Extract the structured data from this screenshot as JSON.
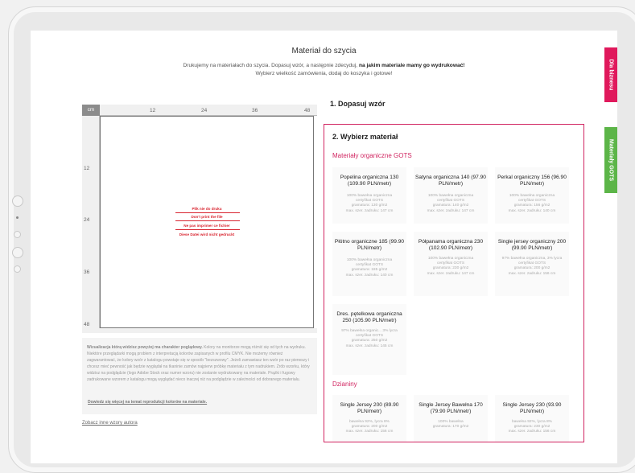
{
  "header": {
    "title": "Materiał do szycia",
    "line1_prefix": "Drukujemy na materiałach do szycia. Dopasuj wzór, a następnie zdecyduj, ",
    "line1_bold": "na jakim materiale mamy go wydrukować!",
    "line2": "Wybierz wielkość zamówienia, dodaj do koszyka i gotowe!"
  },
  "ruler": {
    "unit": "cm",
    "top_ticks": [
      "12",
      "24",
      "36",
      "48"
    ],
    "left_ticks": [
      "12",
      "24",
      "36",
      "48"
    ]
  },
  "preview_warnings": [
    "Plik nie do druku",
    "Don't print the file",
    "Ne pas imprimer ce fichier",
    "Diese Datei wird nicht gedruckt"
  ],
  "info": {
    "bold": "Wizualizacja którą widzisz powyżej ma charakter poglądowy.",
    "text": " Kolory na monitorze mogą różnić się od tych na wydruku. Niektóre przeglądarki mogą problem z interpretacją kolorów zapisanych w profilu CMYK. Nie możemy również zagwarantować, że kolory wzór z katalogu powstaje się w sposób \"bezszwowy\". Jeżeli zamawiasz ten wzór po raz pierwszy i chcesz mieć pewność jak będzie wyglądał na tkaninie zamów najpierw próbkę materiału z tym nadrukiem. Zrób wzorku, który widzisz na podglądzie (logo Adobe Stock oraz numer wzoru) nie zostanie wydrukowany na materiale. Prążki i fugowy zadrukowane wzorem z katalogu mogą wyglądać nieco inaczej niż na podglądzie w zależności od dobranego materiału.",
    "link": "Dowiedz się więcej na temat reprodukcji kolorów na materiale."
  },
  "author_link": "Zobacz inne wzory autora",
  "step1_title": "1. Dopasuj wzór",
  "step2_title": "2. Wybierz materiał",
  "sections": {
    "organic": "Materiały organiczne GOTS",
    "knits": "Dzianiny"
  },
  "organic_materials": [
    {
      "name": "Popelina organiczna 130 (109.90 PLN/metr)",
      "d1": "100% bawełna organiczna",
      "d2": "certyfikat GOTS",
      "d3": "gramatura: 130 g/m2",
      "d4": "max. szer. zadruku: 147 cm"
    },
    {
      "name": "Satyna organiczna 140 (97.90 PLN/metr)",
      "d1": "100% bawełna organiczna",
      "d2": "certyfikat GOTS",
      "d3": "gramatura: 140 g/m2",
      "d4": "max. szer. zadruku: 147 cm"
    },
    {
      "name": "Perkal organiczny 156 (96.90 PLN/metr)",
      "d1": "100% bawełna organiczna",
      "d2": "certyfikat GOTS",
      "d3": "gramatura: 156 g/m2",
      "d4": "max. szer. zadruku: 140 cm"
    },
    {
      "name": "Płótno organiczne 185 (99.90 PLN/metr)",
      "d1": "100% bawełna organiczna",
      "d2": "certyfikat GOTS",
      "d3": "gramatura: 185 g/m2",
      "d4": "max. szer. zadruku: 140 cm"
    },
    {
      "name": "Półpanama organiczna 230 (102.90 PLN/metr)",
      "d1": "100% bawełna organiczna",
      "d2": "certyfikat GOTS",
      "d3": "gramatura: 230 g/m2",
      "d4": "max. szer. zadruku: 147 cm"
    },
    {
      "name": "Single jersey organiczny 200 (99.90 PLN/metr)",
      "d1": "97% bawełna organiczna, 3% lycra",
      "d2": "certyfikat GOTS",
      "d3": "gramatura: 200 g/m2",
      "d4": "max. szer. zadruku: 156 cm"
    },
    {
      "name": "Dres. pętelkowa organiczna 250 (105.90 PLN/metr)",
      "d1": "97% bawełna organic... 3% lycra",
      "d2": "certyfikat GOTS",
      "d3": "gramatura: 250 g/m2",
      "d4": "max. szer. zadruku: 145 cm"
    }
  ],
  "knit_materials": [
    {
      "name": "Single Jersey 200 (89.90 PLN/metr)",
      "d1": "bawełna 92%, lycra 8%",
      "d2": "gramatura: 200 g/m2",
      "d3": "max. szer. zadruku: 156 cm"
    },
    {
      "name": "Single Jersey Bawełna 170 (79.90 PLN/metr)",
      "d1": "100% bawełna",
      "d2": "gramatura: 170 g/m2",
      "d3": ""
    },
    {
      "name": "Single Jersey 230 (93.90 PLN/metr)",
      "d1": "bawełna 92%, lycra 8%",
      "d2": "gramatura: 230 g/m2",
      "d3": "max. szer. zadruku: 156 cm"
    }
  ],
  "side_tabs": {
    "business": "Dla biznesu",
    "gots": "Materiały GOTS"
  },
  "colors": {
    "accent": "#d12561",
    "business_tab": "#e0195c",
    "gots_tab": "#5cb548"
  }
}
